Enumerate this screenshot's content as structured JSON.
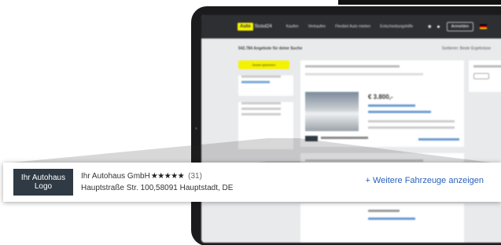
{
  "nav": {
    "logo_badge": "Auto",
    "logo_text": "Scout24",
    "items": [
      "Kaufen",
      "Verkaufen",
      "Flexibel Auto mieten",
      "Entscheidungshilfe"
    ],
    "login_label": "Anmelden"
  },
  "results": {
    "count_text": "542.784 Angebote für deine Suche",
    "sort_text": "Sortieren: Beste Ergebnisse"
  },
  "filter": {
    "save_search_label": "Suche speichern"
  },
  "listing": {
    "price": "€ 3.800,-"
  },
  "dealer": {
    "logo_line1": "Ihr Autohaus",
    "logo_line2": "Logo",
    "name": "Ihr Autohaus GmbH",
    "stars": "★★★★★",
    "rating_count": "(31)",
    "address": "Hauptstraße Str. 100,58091 Hauptstadt, DE",
    "more_vehicles_label": "+ Weitere Fahrzeuge anzeigen",
    "rating_value": 4.5
  },
  "colors": {
    "accent_yellow": "#f5f200",
    "nav_dark": "#2d2f33",
    "link_blue": "#2c62b8",
    "device": "#1b1b1d"
  }
}
